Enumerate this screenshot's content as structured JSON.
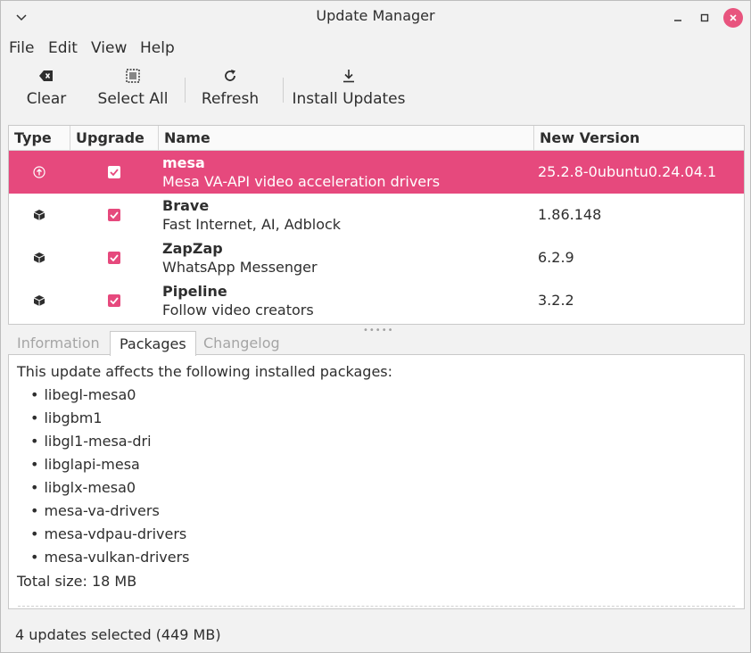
{
  "window": {
    "title": "Update Manager"
  },
  "menu": {
    "file": "File",
    "edit": "Edit",
    "view": "View",
    "help": "Help"
  },
  "toolbar": {
    "clear": "Clear",
    "select_all": "Select All",
    "refresh": "Refresh",
    "install": "Install Updates"
  },
  "table": {
    "headers": {
      "type": "Type",
      "upgrade": "Upgrade",
      "name": "Name",
      "version": "New Version"
    },
    "rows": [
      {
        "name": "mesa",
        "desc": "Mesa VA-API video acceleration drivers",
        "version": "25.2.8-0ubuntu0.24.04.1",
        "type_icon": "system-upgrade-icon",
        "checked": true,
        "selected": true
      },
      {
        "name": "Brave",
        "desc": "Fast Internet, AI, Adblock",
        "version": "1.86.148",
        "type_icon": "package-icon",
        "checked": true,
        "selected": false
      },
      {
        "name": "ZapZap",
        "desc": "WhatsApp Messenger",
        "version": "6.2.9",
        "type_icon": "package-icon",
        "checked": true,
        "selected": false
      },
      {
        "name": "Pipeline",
        "desc": "Follow video creators",
        "version": "3.2.2",
        "type_icon": "package-icon",
        "checked": true,
        "selected": false
      }
    ]
  },
  "tabs": {
    "information": "Information",
    "packages": "Packages",
    "changelog": "Changelog",
    "active": "packages"
  },
  "packages_panel": {
    "intro": "This update affects the following installed packages:",
    "packages": [
      "libegl-mesa0",
      "libgbm1",
      "libgl1-mesa-dri",
      "libglapi-mesa",
      "libglx-mesa0",
      "mesa-va-drivers",
      "mesa-vdpau-drivers",
      "mesa-vulkan-drivers"
    ],
    "total": "Total size: 18 MB"
  },
  "status": {
    "text": "4 updates selected (449 MB)"
  },
  "colors": {
    "accent": "#e6497d",
    "close_button": "#e8547e"
  }
}
